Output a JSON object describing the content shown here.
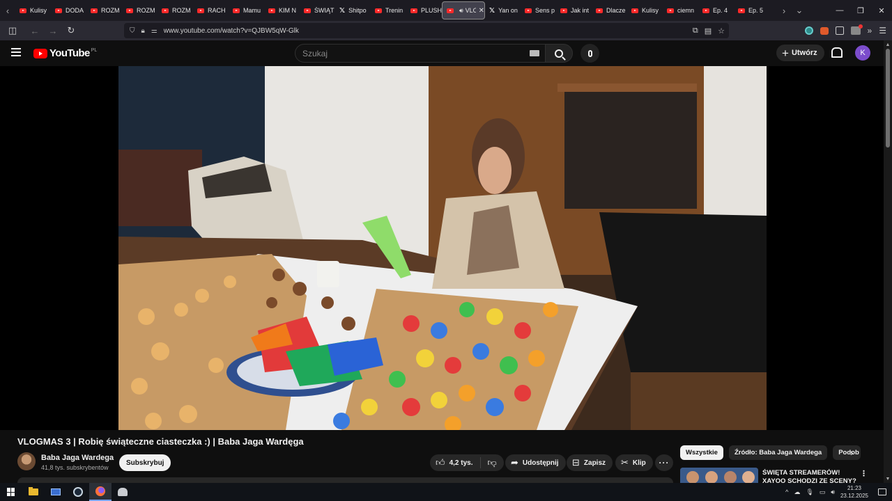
{
  "browser": {
    "tabs": [
      {
        "label": "Kulisy",
        "icon": "youtube-icon"
      },
      {
        "label": "DODA",
        "icon": "youtube-icon"
      },
      {
        "label": "ROZM",
        "icon": "youtube-icon"
      },
      {
        "label": "ROZM",
        "icon": "youtube-icon"
      },
      {
        "label": "ROZM",
        "icon": "youtube-icon"
      },
      {
        "label": "RACH",
        "icon": "youtube-icon"
      },
      {
        "label": "Mamu",
        "icon": "youtube-icon"
      },
      {
        "label": "KIM N",
        "icon": "youtube-icon"
      },
      {
        "label": "ŚWIĄT",
        "icon": "youtube-icon"
      },
      {
        "label": "Shitpo",
        "icon": "x-icon"
      },
      {
        "label": "Trenin",
        "icon": "youtube-icon"
      },
      {
        "label": "PLUSH",
        "icon": "youtube-icon"
      },
      {
        "label": "VLOG",
        "icon": "youtube-icon",
        "active": true
      },
      {
        "label": "Yan on",
        "icon": "x-icon"
      },
      {
        "label": "Sens p",
        "icon": "youtube-icon"
      },
      {
        "label": "Jak int",
        "icon": "youtube-icon"
      },
      {
        "label": "Dlacze",
        "icon": "youtube-icon"
      },
      {
        "label": "Kulisy",
        "icon": "youtube-icon"
      },
      {
        "label": "ciemn",
        "icon": "youtube-icon"
      },
      {
        "label": "Ep. 4",
        "icon": "youtube-icon"
      },
      {
        "label": "Ep. 5",
        "icon": "youtube-icon"
      }
    ],
    "url": "www.youtube.com/watch?v=QJBW5qW-Glk"
  },
  "youtube": {
    "logo_text": "YouTube",
    "country_code": "PL",
    "search_placeholder": "Szukaj",
    "create_label": "Utwórz",
    "avatar_letter": "K"
  },
  "video": {
    "title": "VLOGMAS 3 | Robię świąteczne ciasteczka :) | Baba Jaga Wardęga",
    "channel_name": "Baba Jaga Wardega",
    "subscribers": "41,8 tys. subskrybentów",
    "subscribe_label": "Subskrybuj",
    "likes": "4,2 tys.",
    "share_label": "Udostępnij",
    "save_label": "Zapisz",
    "clip_label": "Klip"
  },
  "sidebar": {
    "chips": [
      "Wszystkie",
      "Źródło: Baba Jaga Wardega",
      "Podob"
    ],
    "recommended_title": "ŚWIĘTA STREAMERÓW! XAYOO SCHODZI ZE SCENY?"
  },
  "taskbar": {
    "time": "21:23",
    "date": "23.12.2025"
  }
}
